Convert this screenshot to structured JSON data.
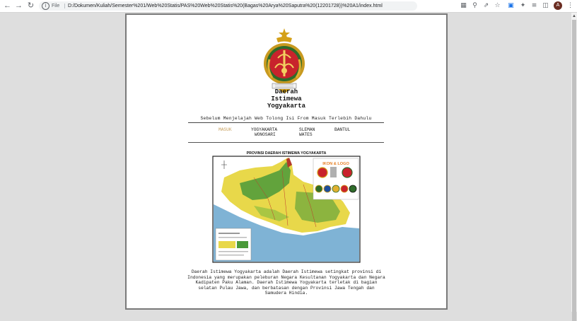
{
  "browser": {
    "back": "←",
    "forward": "→",
    "reload": "↻",
    "scheme_label": "File",
    "url": "D:/Dokumen/Kuliah/Semester%201/Web%20Statis/PAS%20Web%20Statis%20(Bagas%20Arya%20Saputra%20(12201728))%20A1/index.html",
    "avatar_letter": "A",
    "toolbar_icons": [
      "translate-icon",
      "zoom-icon",
      "share-icon",
      "star-icon",
      "extension-translate-icon",
      "puzzle-icon",
      "reading-list-icon",
      "side-panel-icon",
      "menu-icon"
    ]
  },
  "page": {
    "logo_alt": "Lambang Daerah Istimewa Yogyakarta",
    "title_lines": [
      "Daerah",
      "Istimewa",
      "Yogyakarta"
    ],
    "notice": "Sebelum Menjelajah Web Tolong Isi From Masuk Terlebih Dahulu",
    "nav": {
      "masuk": "MASUK",
      "yogyakarta": "YOGYAKARTA",
      "wonosari": "WONOSARI",
      "sleman": "SLEMAN",
      "wates": "WATES",
      "bantul": "BANTUL"
    },
    "map": {
      "title": "PROVINSI DAERAH ISTIMEWA YOGYAKARTA",
      "inset_title": "IKON & LOGO"
    },
    "description": "Daerah Istimewa Yogyakarta adalah Daerah Istimewa setingkat provinsi di Indonesia yang merupakan peleburan Negara Kesultanan Yogyakarta dan Negara Kadipaten Paku Alaman. Daerah Istimewa Yogyakarta terletak di bagian selatan Pulau Jawa, dan berbatasan dengan Provinsi Jawa Tengah dan Samudera Hindia."
  },
  "colors": {
    "active_link": "#c8a060",
    "emblem_red": "#c8232c",
    "emblem_gold": "#d4a017",
    "sea_blue": "#7fb3d5",
    "land_yellow": "#e8d84a",
    "land_green": "#4a9a3a"
  }
}
